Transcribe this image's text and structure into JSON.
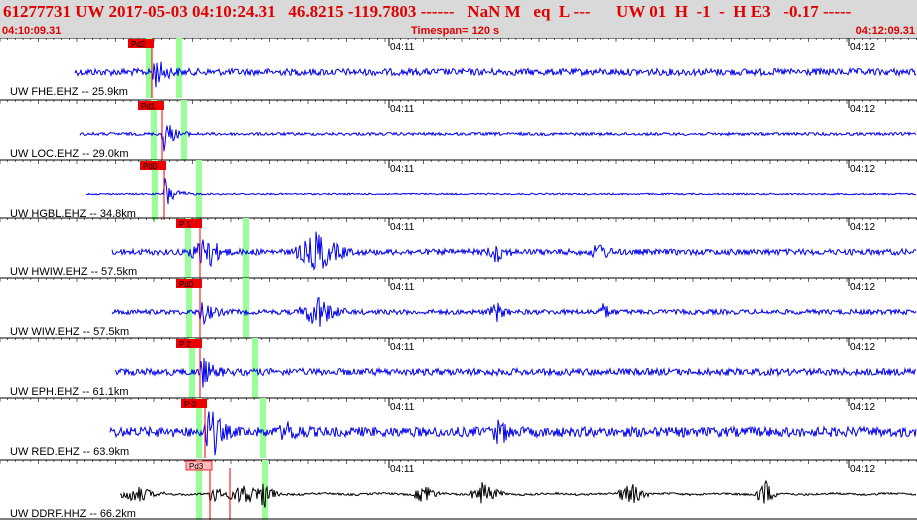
{
  "header": {
    "title": "61277731 UW 2017-05-03 04:10:24.31   46.8215 -119.7803 ------   NaN M   eq  L ---      UW 01  H  -1  -  H E3   -0.17 -----",
    "start_time": "04:10:09.31",
    "timespan": "Timespan= 120 s",
    "end_time": "04:12:09.31"
  },
  "time_axis": {
    "tick_labels": [
      "04:11",
      "04:12"
    ]
  },
  "colors": {
    "trace": "#0000ee",
    "trace_broadband": "#000000",
    "pick_fill": "#ee0000",
    "pick_light": "#ffbbbb",
    "band": "#99ff99",
    "label": "#000000"
  },
  "traces": [
    {
      "label": "UW FHE.EHZ -- 25.9km",
      "pick": "Pd2",
      "pick_style": "solid"
    },
    {
      "label": "UW LOC.EHZ -- 29.0km",
      "pick": "Pd1",
      "pick_style": "solid"
    },
    {
      "label": "UW HGBL.EHZ -- 34.8km",
      "pick": "Pd0",
      "pick_style": "solid"
    },
    {
      "label": "UW HWIW.EHZ -- 57.5km",
      "pick": "P 1",
      "pick_style": "solid"
    },
    {
      "label": "UW WIW.EHZ -- 57.5km",
      "pick": "Pd0",
      "pick_style": "solid"
    },
    {
      "label": "UW EPH.EHZ -- 61.1km",
      "pick": "P 2",
      "pick_style": "solid"
    },
    {
      "label": "UW RED.EHZ -- 63.9km",
      "pick": "P 0",
      "pick_style": "solid"
    },
    {
      "label": "UW DDRF.HHZ -- 66.2km",
      "pick": "Pd3",
      "pick_style": "light"
    }
  ]
}
